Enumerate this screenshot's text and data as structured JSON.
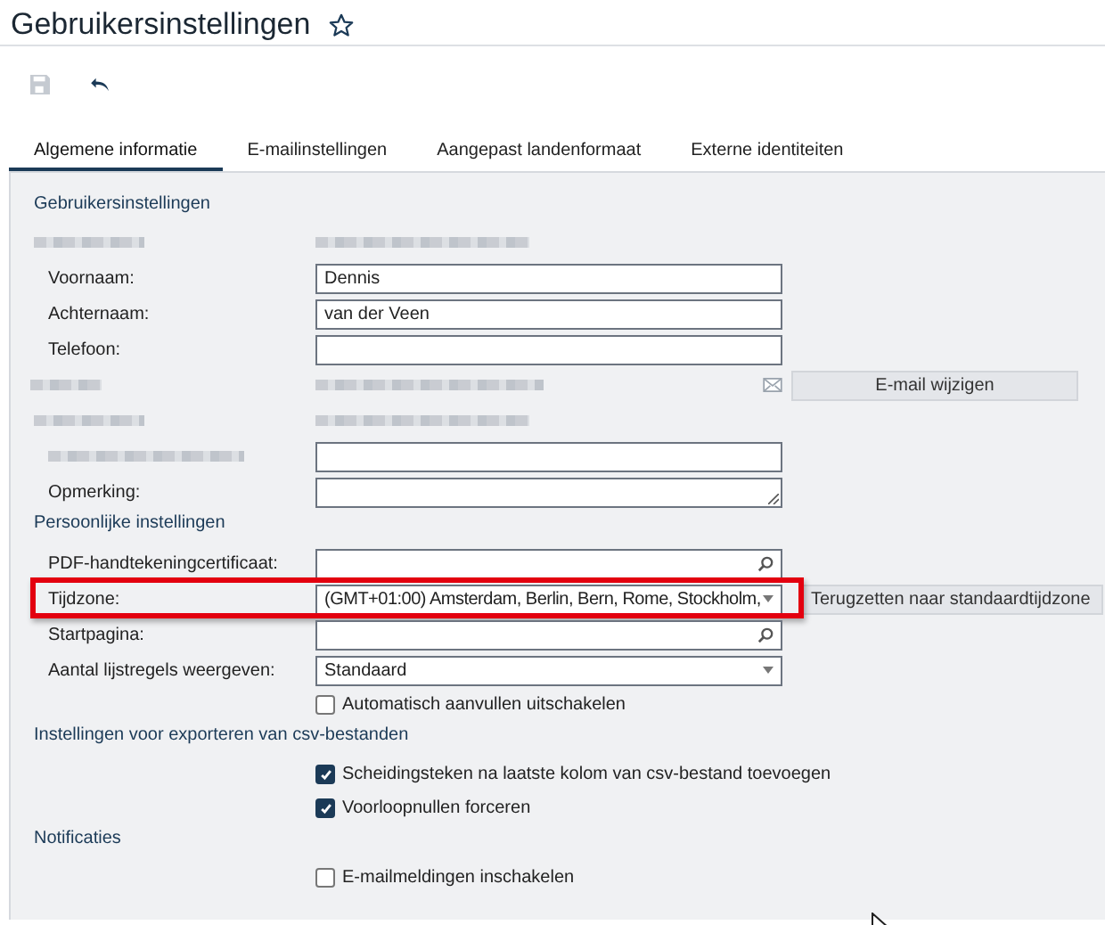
{
  "page": {
    "title": "Gebruikersinstellingen",
    "favorite": false
  },
  "tabs": [
    {
      "label": "Algemene informatie",
      "selected": true
    },
    {
      "label": "E-mailinstellingen",
      "selected": false
    },
    {
      "label": "Aangepast landenformaat",
      "selected": false
    },
    {
      "label": "Externe identiteiten",
      "selected": false
    }
  ],
  "sections": [
    {
      "heading": "Gebruikersinstellingen",
      "rows": [
        {
          "kind": "redacted-info"
        },
        {
          "kind": "field",
          "label": "Voornaam:",
          "value": "Dennis"
        },
        {
          "kind": "field",
          "label": "Achternaam:",
          "value": "van der Veen"
        },
        {
          "kind": "field",
          "label": "Telefoon:"
        },
        {
          "kind": "redacted-email",
          "button": "E-mail wijzigen"
        },
        {
          "kind": "redacted-info"
        },
        {
          "kind": "redacted-field"
        },
        {
          "kind": "textarea",
          "label": "Opmerking:"
        }
      ]
    },
    {
      "heading": "Persoonlijke instellingen",
      "rows": [
        {
          "kind": "search",
          "label": "PDF-handtekeningcertificaat:"
        },
        {
          "kind": "select",
          "label": "Tijdzone:",
          "value": "(GMT+01:00) Amsterdam, Berlin, Bern, Rome, Stockholm,",
          "button": "Terugzetten naar standaardtijdzone",
          "highlighted": true
        },
        {
          "kind": "search",
          "label": "Startpagina:"
        },
        {
          "kind": "select",
          "label": "Aantal lijstregels weergeven:",
          "value": "Standaard"
        },
        {
          "kind": "checkbox",
          "label": "Automatisch aanvullen uitschakelen",
          "checked": false
        }
      ]
    },
    {
      "heading": "Instellingen voor exporteren van csv-bestanden",
      "rows": [
        {
          "kind": "checkbox",
          "label": "Scheidingsteken na laatste kolom van csv-bestand toevoegen",
          "checked": true
        },
        {
          "kind": "checkbox",
          "label": "Voorloopnullen forceren",
          "checked": true
        }
      ]
    },
    {
      "heading": "Notificaties",
      "rows": [
        {
          "kind": "checkbox",
          "label": "E-mailmeldingen inschakelen",
          "checked": false
        }
      ]
    }
  ]
}
